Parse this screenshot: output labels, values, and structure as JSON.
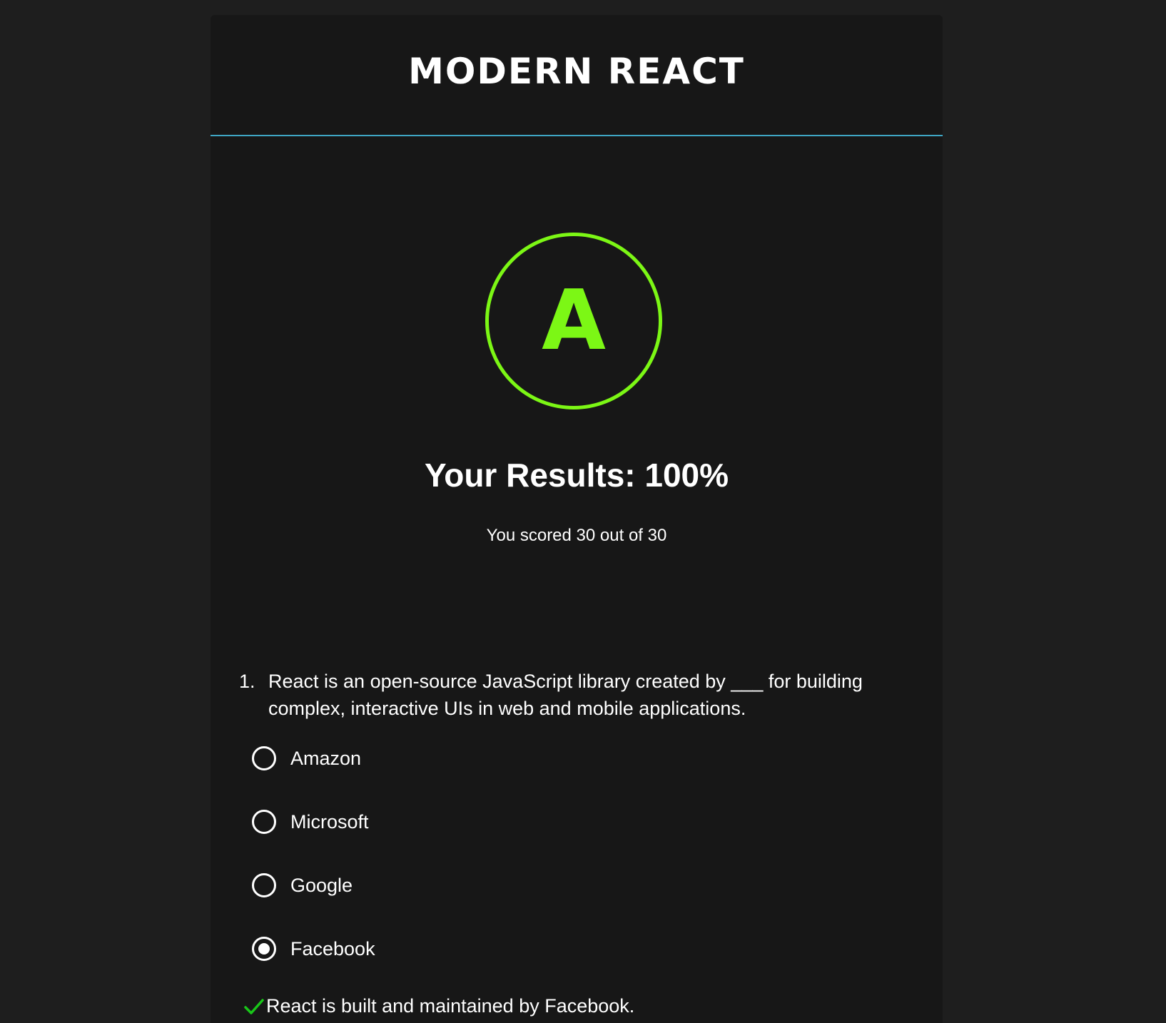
{
  "header": {
    "title": "MODERN REACT"
  },
  "result": {
    "grade": "A",
    "title": "Your Results: 100%",
    "score_text": "You scored 30 out of 30",
    "percent": 100,
    "ring_color": "#7cf715"
  },
  "question": {
    "number": "1.",
    "text": "React is an open-source JavaScript library created by ___ for building complex, interactive UIs in web and mobile applications.",
    "options": [
      {
        "label": "Amazon",
        "selected": false
      },
      {
        "label": "Microsoft",
        "selected": false
      },
      {
        "label": "Google",
        "selected": false
      },
      {
        "label": "Facebook",
        "selected": true
      }
    ],
    "feedback": {
      "icon": "check-icon",
      "text": "React is built and maintained by Facebook.",
      "color": "#19c619"
    }
  },
  "colors": {
    "page_bg": "#1e1e1e",
    "card_bg": "#171717",
    "header_rule": "#3fa6c4"
  }
}
